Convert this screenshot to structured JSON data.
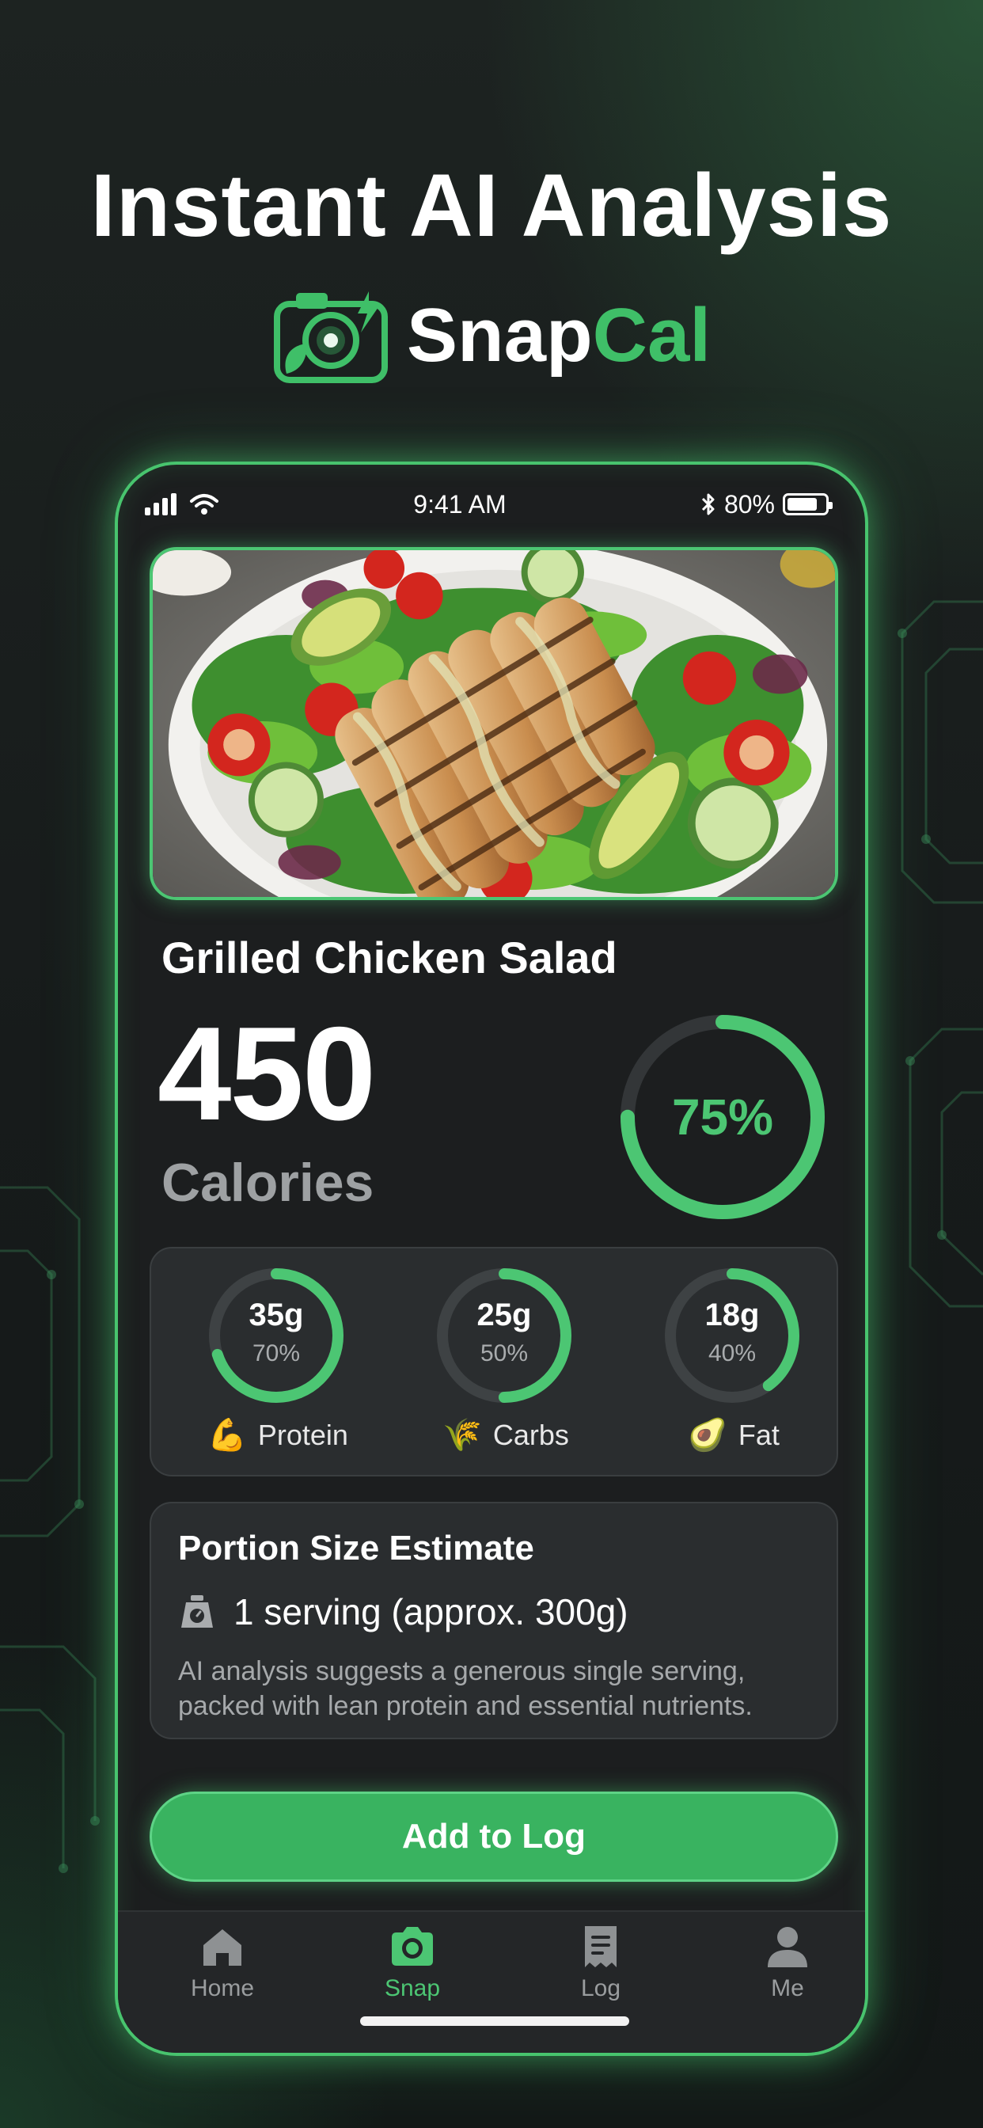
{
  "hero": {
    "title": "Instant AI Analysis"
  },
  "brand": {
    "name_part1": "Snap",
    "name_part2": "Cal",
    "accent_color": "#3fbf68",
    "logo_icon": "camera-leaf-lightning-icon"
  },
  "status_bar": {
    "time": "9:41 AM",
    "battery": "80%",
    "battery_level": 0.8,
    "icons": [
      "signal-icon",
      "wifi-icon",
      "bluetooth-icon",
      "battery-icon"
    ]
  },
  "meal": {
    "photo": "grilled-chicken-salad-photo",
    "name": "Grilled Chicken Salad",
    "calories": "450",
    "calories_label": "Calories",
    "goal_progress_label": "75%",
    "goal_progress": 0.75
  },
  "macros": [
    {
      "grams": "35g",
      "percent_label": "70%",
      "percent": 0.7,
      "name": "Protein",
      "icon": "flexed-biceps-icon",
      "emoji": "💪"
    },
    {
      "grams": "25g",
      "percent_label": "50%",
      "percent": 0.5,
      "name": "Carbs",
      "icon": "sheaf-of-rice-icon",
      "emoji": "🌾"
    },
    {
      "grams": "18g",
      "percent_label": "40%",
      "percent": 0.4,
      "name": "Fat",
      "icon": "avocado-icon",
      "emoji": "🥑"
    }
  ],
  "portion": {
    "title": "Portion Size Estimate",
    "serving": "1 serving (approx. 300g)",
    "description": "AI analysis suggests a generous single serving, packed with lean protein and essential nutrients.",
    "icon": "scale-icon"
  },
  "actions": {
    "add_to_log": "Add to Log"
  },
  "tabs": [
    {
      "label": "Home",
      "icon": "home-icon",
      "active": false
    },
    {
      "label": "Snap",
      "icon": "camera-icon",
      "active": true
    },
    {
      "label": "Log",
      "icon": "receipt-icon",
      "active": false
    },
    {
      "label": "Me",
      "icon": "person-icon",
      "active": false
    }
  ],
  "colors": {
    "accent": "#4cc673",
    "button": "#39b360",
    "card": "#2a2d2f",
    "phone_bg": "#1c1e1f"
  }
}
